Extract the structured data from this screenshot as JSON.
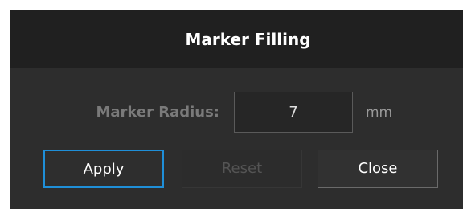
{
  "dialog": {
    "title": "Marker Filling",
    "field": {
      "label": "Marker Radius:",
      "value": "7",
      "unit": "mm"
    },
    "buttons": {
      "apply": "Apply",
      "reset": "Reset",
      "close": "Close"
    },
    "states": {
      "reset_enabled": false,
      "focused_button": "Apply"
    },
    "colors": {
      "background": "#2d2d2d",
      "titlebar": "#202020",
      "focus_accent": "#1f8fd8"
    }
  }
}
